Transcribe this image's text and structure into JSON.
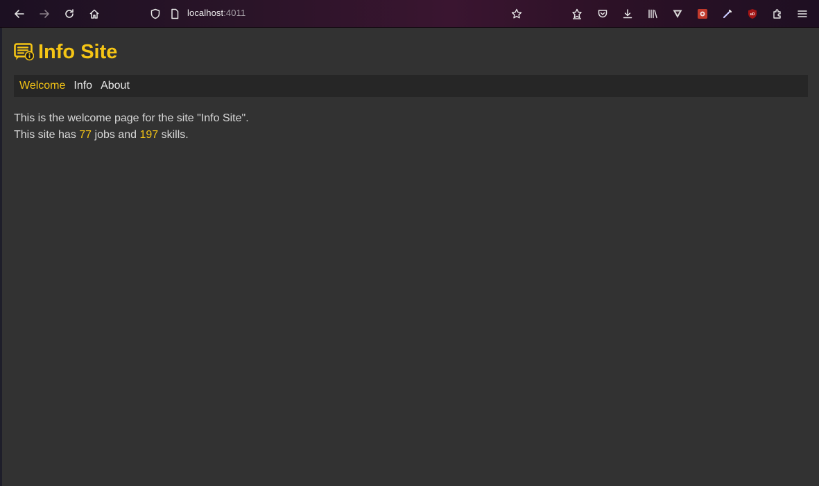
{
  "browser": {
    "url_host": "localhost",
    "url_port": ":4011",
    "icons": [
      "back-icon",
      "forward-icon",
      "reload-icon",
      "home-icon",
      "shield-icon",
      "page-icon",
      "bookmark-star-icon",
      "extension-icon",
      "pocket-icon",
      "download-icon",
      "library-icon",
      "vimium-icon",
      "extension-red-icon",
      "wand-icon",
      "ublock-icon",
      "extensions-puzzle-icon",
      "menu-icon"
    ]
  },
  "site": {
    "title": "Info Site",
    "accent": "#f5c515"
  },
  "nav": {
    "items": [
      {
        "label": "Welcome",
        "active": true
      },
      {
        "label": "Info",
        "active": false
      },
      {
        "label": "About",
        "active": false
      }
    ]
  },
  "content": {
    "line1": "This is the welcome page for the site \"Info Site\".",
    "line2_prefix": "This site has ",
    "jobs_count": "77",
    "line2_mid": " jobs and ",
    "skills_count": "197",
    "line2_suffix": " skills."
  }
}
